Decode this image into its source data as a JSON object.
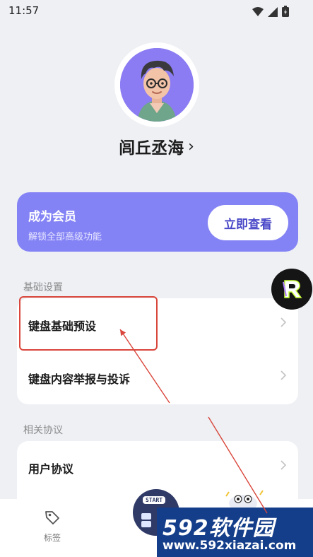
{
  "status_bar": {
    "time": "11:57"
  },
  "profile": {
    "name": "闾丘丞海",
    "chevron": "›"
  },
  "vip": {
    "title": "成为会员",
    "subtitle": "解锁全部高级功能",
    "button_label": "立即查看"
  },
  "basic_settings": {
    "title": "基础设置",
    "items": [
      {
        "label": "键盘基础预设"
      },
      {
        "label": "键盘内容举报与投诉"
      }
    ]
  },
  "agreements": {
    "title": "相关协议",
    "items": [
      {
        "label": "用户协议"
      }
    ]
  },
  "bottom_nav": {
    "tags_label": "标签",
    "start_label": "START"
  },
  "watermark": {
    "brand": "592软件园",
    "url": "www.592xiazai.com"
  },
  "colors": {
    "accent": "#8483f5",
    "annotation": "#d9463b",
    "watermark_bg": "#153e8a"
  }
}
